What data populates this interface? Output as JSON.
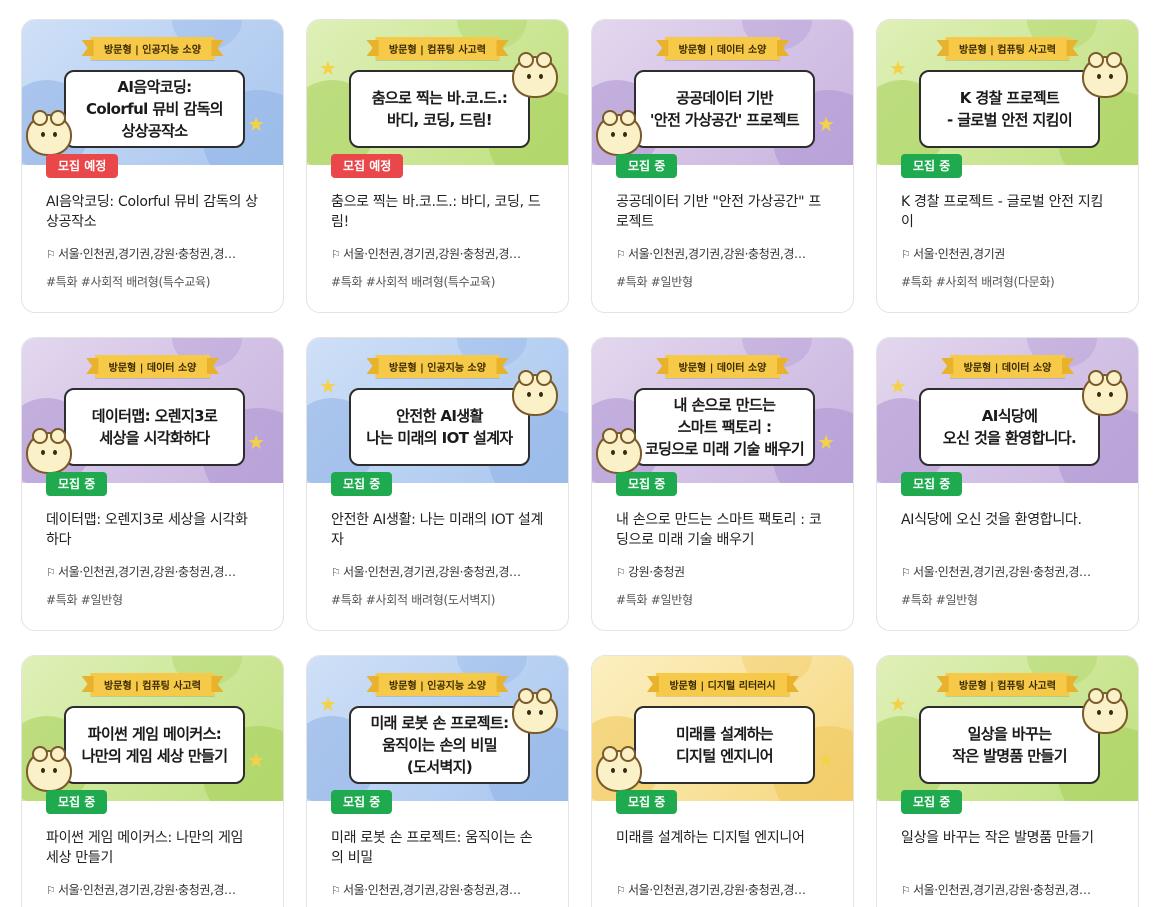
{
  "cards": [
    {
      "theme": "blue",
      "ribbon": "방문형 | 인공지능 소양",
      "panel": "AI음악코딩:\nColorful 뮤비 감독의\n상상공작소",
      "status": "모집 예정",
      "status_type": "soon",
      "title": "AI음악코딩: Colorful 뮤비 감독의 상상공작소",
      "location": "서울·인천권,경기권,강원·충청권,경…",
      "tags": "#특화 #사회적 배려형(특수교육)"
    },
    {
      "theme": "green",
      "ribbon": "방문형 | 컴퓨팅 사고력",
      "panel": "춤으로 찍는 바.코.드.:\n바디, 코딩, 드림!",
      "status": "모집 예정",
      "status_type": "soon",
      "title": "춤으로 찍는 바.코.드.: 바디, 코딩, 드림!",
      "location": "서울·인천권,경기권,강원·충청권,경…",
      "tags": "#특화 #사회적 배려형(특수교육)"
    },
    {
      "theme": "purple",
      "ribbon": "방문형 | 데이터 소양",
      "panel": "공공데이터 기반\n'안전 가상공간' 프로젝트",
      "status": "모집 중",
      "status_type": "open",
      "title": "공공데이터 기반 \"안전 가상공간\" 프로젝트",
      "location": "서울·인천권,경기권,강원·충청권,경…",
      "tags": "#특화 #일반형"
    },
    {
      "theme": "green",
      "ribbon": "방문형 | 컴퓨팅 사고력",
      "panel": "K 경찰 프로젝트\n- 글로벌 안전 지킴이",
      "status": "모집 중",
      "status_type": "open",
      "title": "K 경찰 프로젝트 - 글로벌 안전 지킴이",
      "location": "서울·인천권,경기권",
      "tags": "#특화 #사회적 배려형(다문화)"
    },
    {
      "theme": "purple",
      "ribbon": "방문형 | 데이터 소양",
      "panel": "데이터맵: 오렌지3로\n세상을 시각화하다",
      "status": "모집 중",
      "status_type": "open",
      "title": "데이터맵: 오렌지3로 세상을 시각화하다",
      "location": "서울·인천권,경기권,강원·충청권,경…",
      "tags": "#특화 #일반형"
    },
    {
      "theme": "blue",
      "ribbon": "방문형 | 인공지능 소양",
      "panel": "안전한 AI생활\n나는 미래의 IOT 설계자",
      "status": "모집 중",
      "status_type": "open",
      "title": "안전한 AI생활: 나는 미래의 IOT 설계자",
      "location": "서울·인천권,경기권,강원·충청권,경…",
      "tags": "#특화 #사회적 배려형(도서벽지)"
    },
    {
      "theme": "purple",
      "ribbon": "방문형 | 데이터 소양",
      "panel": "내 손으로 만드는\n스마트 팩토리 :\n코딩으로 미래 기술 배우기",
      "status": "모집 중",
      "status_type": "open",
      "title": "내 손으로 만드는 스마트 팩토리 : 코딩으로 미래 기술 배우기",
      "location": "강원·충청권",
      "tags": "#특화 #일반형"
    },
    {
      "theme": "purple",
      "ribbon": "방문형 | 데이터 소양",
      "panel": "AI식당에\n오신 것을 환영합니다.",
      "status": "모집 중",
      "status_type": "open",
      "title": "AI식당에 오신 것을 환영합니다.",
      "location": "서울·인천권,경기권,강원·충청권,경…",
      "tags": "#특화 #일반형"
    },
    {
      "theme": "green",
      "ribbon": "방문형 | 컴퓨팅 사고력",
      "panel": "파이썬 게임 메이커스:\n나만의 게임 세상 만들기",
      "status": "모집 중",
      "status_type": "open",
      "title": "파이썬 게임 메이커스: 나만의 게임 세상 만들기",
      "location": "서울·인천권,경기권,강원·충청권,경…",
      "tags": ""
    },
    {
      "theme": "blue",
      "ribbon": "방문형 | 인공지능 소양",
      "panel": "미래 로봇 손 프로젝트:\n움직이는 손의 비밀\n(도서벽지)",
      "status": "모집 중",
      "status_type": "open",
      "title": "미래 로봇 손 프로젝트: 움직이는 손의 비밀",
      "location": "서울·인천권,경기권,강원·충청권,경…",
      "tags": ""
    },
    {
      "theme": "yellow",
      "ribbon": "방문형 | 디지털 리터러시",
      "panel": "미래를 설계하는\n디지털 엔지니어",
      "status": "모집 중",
      "status_type": "open",
      "title": "미래를 설계하는 디지털 엔지니어",
      "location": "서울·인천권,경기권,강원·충청권,경…",
      "tags": ""
    },
    {
      "theme": "green",
      "ribbon": "방문형 | 컴퓨팅 사고력",
      "panel": "일상을 바꾸는\n작은 발명품 만들기",
      "status": "모집 중",
      "status_type": "open",
      "title": "일상을 바꾸는 작은 발명품 만들기",
      "location": "서울·인천권,경기권,강원·충청권,경…",
      "tags": ""
    }
  ],
  "icons": {
    "location": "flag-icon",
    "decor": "mascot-icon"
  },
  "colors": {
    "open": "#1faa4f",
    "soon": "#e9474a",
    "ribbon": "#f7c948"
  }
}
